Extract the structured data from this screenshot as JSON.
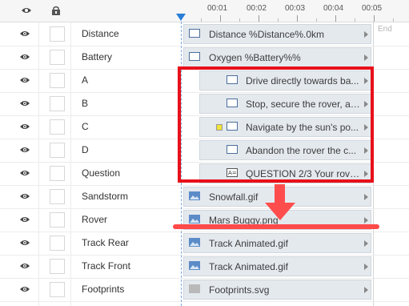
{
  "timeline": {
    "ticks": [
      "00:01",
      "00:02",
      "00:03",
      "00:04",
      "00:05"
    ],
    "end_label": "End"
  },
  "rows": [
    {
      "name": "Distance",
      "bar_text": "Distance %Distance%.0km",
      "icon": "text-box-icon"
    },
    {
      "name": "Battery",
      "bar_text": "Oxygen %Battery%%",
      "icon": "text-box-icon"
    },
    {
      "name": "A",
      "bar_text": "Drive directly towards ba...",
      "icon": "text-box-icon"
    },
    {
      "name": "B",
      "bar_text": "Stop, secure the rover, an...",
      "icon": "text-box-icon"
    },
    {
      "name": "C",
      "bar_text": "Navigate by the sun's po...",
      "icon": "text-box-icon"
    },
    {
      "name": "D",
      "bar_text": "Abandon the rover the c...",
      "icon": "text-box-icon"
    },
    {
      "name": "Question",
      "bar_text": "QUESTION 2/3 Your rove...",
      "icon": "question-text-icon"
    },
    {
      "name": "Sandstorm",
      "bar_text": "Snowfall.gif",
      "icon": "image-icon"
    },
    {
      "name": "Rover",
      "bar_text": "Mars Buggy.png",
      "icon": "image-icon"
    },
    {
      "name": "Track Rear",
      "bar_text": "Track Animated.gif",
      "icon": "image-icon"
    },
    {
      "name": "Track Front",
      "bar_text": "Track Animated.gif",
      "icon": "image-icon"
    },
    {
      "name": "Footprints",
      "bar_text": "Footprints.svg",
      "icon": "svg-icon"
    }
  ],
  "colors": {
    "annotation_red": "#e8101a",
    "playhead_blue": "#2a7ed8"
  }
}
